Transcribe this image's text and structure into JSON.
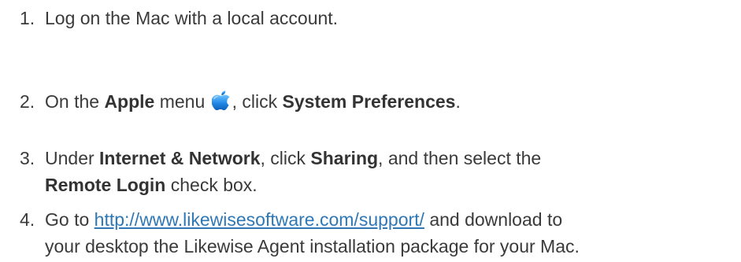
{
  "steps": [
    {
      "number": "1.",
      "text": "Log on the Mac with a local account."
    },
    {
      "number": "2.",
      "pre": "On the ",
      "bold1": "Apple",
      "mid": " menu ",
      "icon": "apple-logo-icon",
      "post": ", click ",
      "bold2": "System Preferences",
      "end": "."
    },
    {
      "number": "3.",
      "pre": "Under ",
      "bold1": "Internet & Network",
      "mid": ", click ",
      "bold2": "Sharing",
      "post": ", and then select the",
      "bold3": "Remote Login",
      "end": " check box."
    },
    {
      "number": "4.",
      "pre": "Go to ",
      "link": "http://www.likewisesoftware.com/support/",
      "post": " and download to",
      "line2": "your desktop the Likewise Agent installation package for your Mac."
    }
  ],
  "colors": {
    "text": "#3a3a3a",
    "link": "#2f77b5",
    "apple_icon": "#1e88e5"
  }
}
